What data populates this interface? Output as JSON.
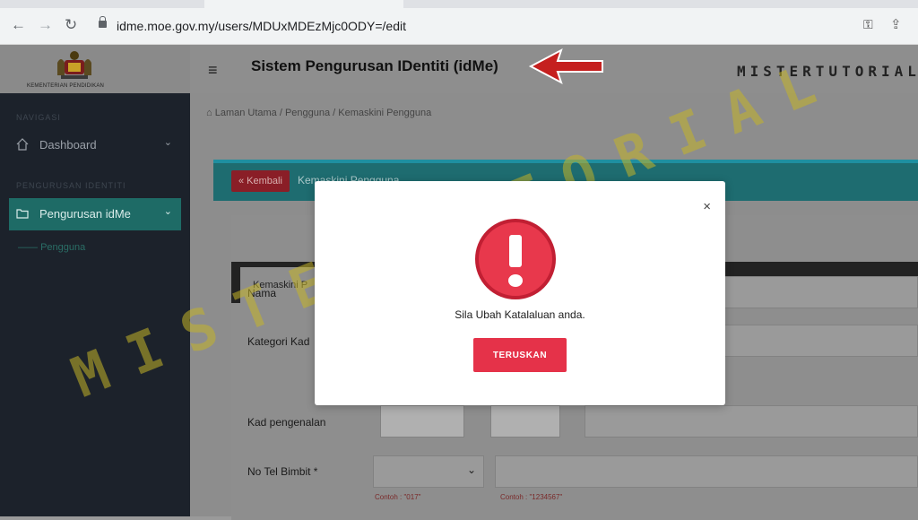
{
  "browser": {
    "url": "idme.moe.gov.my/users/MDUxMDEzMjc0ODY=/edit"
  },
  "header": {
    "title": "Sistem Pengurusan IDentiti (idMe)",
    "brand": "MISTERTUTORIAL"
  },
  "logo": {
    "caption": "KEMENTERIAN PENDIDIKAN"
  },
  "sidebar": {
    "section1": "NAVIGASI",
    "section2": "PENGURUSAN IDENTITI",
    "items": [
      {
        "label": "Dashboard"
      },
      {
        "label": "Pengurusan idMe"
      }
    ],
    "sub_item": "Pengguna"
  },
  "breadcrumb": "Laman Utama  /  Pengguna  /  Kemaskini Pengguna",
  "panel": {
    "back_label": "« Kembali",
    "title": "Kemaskini Pengguna"
  },
  "form": {
    "tab_label": "Kemaskini P",
    "fields": {
      "nama": "Nama",
      "kategori": "Kategori Kad",
      "kad": "Kad pengenalan",
      "tel": "No Tel Bimbit *"
    },
    "hint1": "Contoh : \"017\"",
    "hint2": "Contoh : \"1234567\""
  },
  "watermark": "MISTERTUTORIAL",
  "modal": {
    "message": "Sila Ubah Katalaluan anda.",
    "button": "TERUSKAN",
    "close": "×"
  },
  "colors": {
    "accent": "#1e6b66",
    "danger": "#e53249",
    "sidebar": "#1c222b"
  }
}
